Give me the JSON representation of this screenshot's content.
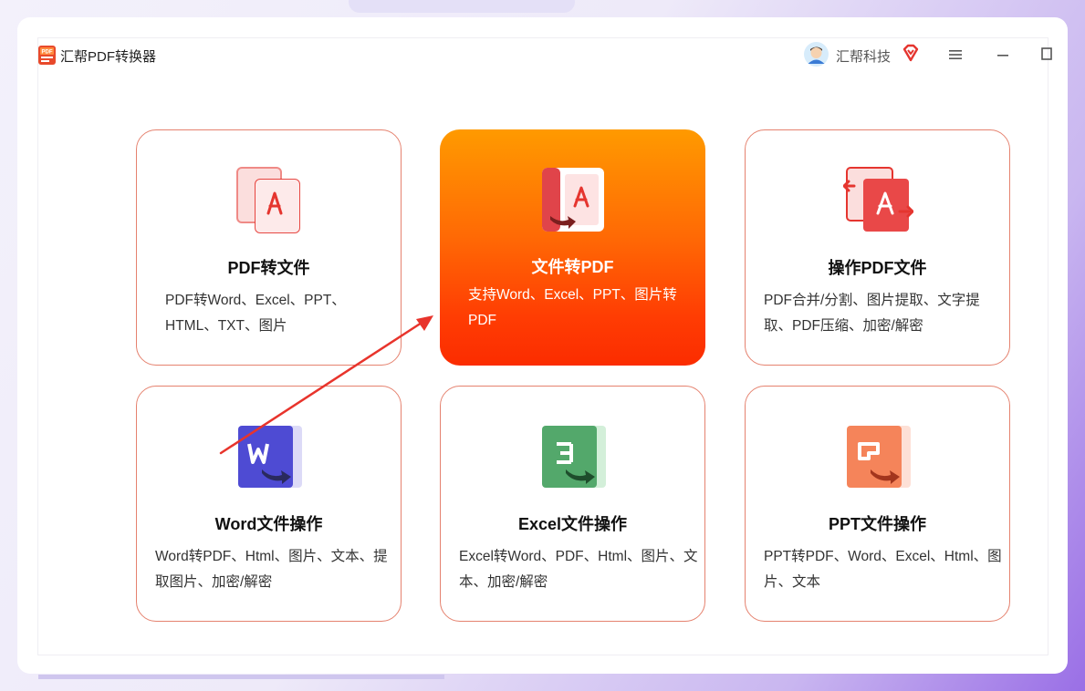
{
  "app": {
    "title": "汇帮PDF转换器",
    "logo_icon": "pdf-logo-icon"
  },
  "user": {
    "name": "汇帮科技",
    "vip_icon": "vip-diamond-icon"
  },
  "window_controls": [
    "menu-icon",
    "minimize-icon",
    "maximize-icon"
  ],
  "colors": {
    "accent": "#ff5a05",
    "card_border": "#e5826f",
    "red": "#e5352f"
  },
  "cards": [
    {
      "title": "PDF转文件",
      "desc": "PDF转Word、Excel、PPT、HTML、TXT、图片",
      "icon": "pdf-to-file-icon"
    },
    {
      "title": "文件转PDF",
      "desc": "支持Word、Excel、PPT、图片转PDF",
      "icon": "file-to-pdf-icon",
      "selected": true
    },
    {
      "title": "操作PDF文件",
      "desc": "PDF合并/分割、图片提取、文字提取、PDF压缩、加密/解密",
      "icon": "pdf-operations-icon"
    },
    {
      "title": "Word文件操作",
      "desc": "Word转PDF、Html、图片、文本、提取图片、加密/解密",
      "icon": "word-icon"
    },
    {
      "title": "Excel文件操作",
      "desc": "Excel转Word、PDF、Html、图片、文本、加密/解密",
      "icon": "excel-icon"
    },
    {
      "title": "PPT文件操作",
      "desc": "PPT转PDF、Word、Excel、Html、图片、文本",
      "icon": "ppt-icon"
    }
  ]
}
